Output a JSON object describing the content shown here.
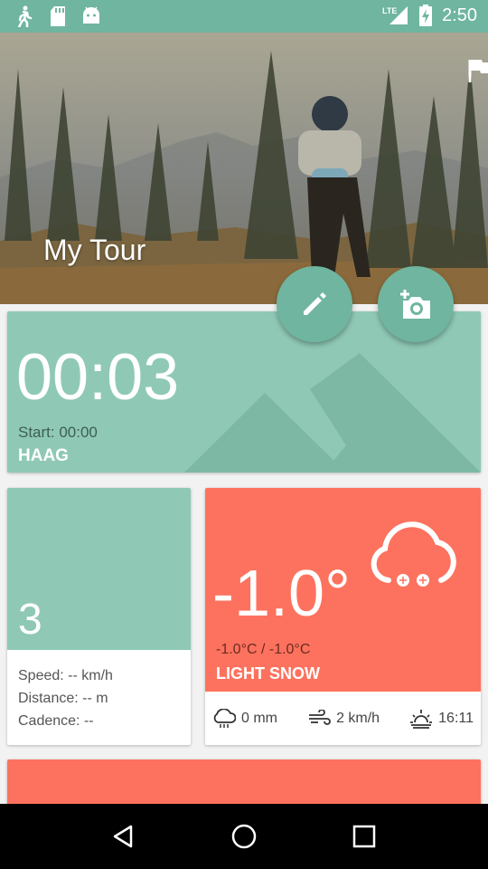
{
  "status_bar": {
    "time": "2:50",
    "network": "LTE",
    "icons": [
      "walk-icon",
      "sd-card-icon",
      "android-icon",
      "signal-icon",
      "battery-charging-icon"
    ]
  },
  "hero": {
    "title": "My Tour",
    "flag_icon": "flag-icon"
  },
  "actions": {
    "edit_icon": "pencil-icon",
    "camera_icon": "add-photo-icon"
  },
  "timer_card": {
    "elapsed": "00:03",
    "start": "Start: 00:00",
    "location": "HAAG"
  },
  "stats_card": {
    "value": "3",
    "speed": "Speed: -- km/h",
    "distance": "Distance: -- m",
    "cadence": "Cadence: --"
  },
  "weather_card": {
    "temperature": "-1.0°",
    "range": "-1.0°C / -1.0°C",
    "condition": "LIGHT SNOW",
    "icon": "snow-cloud-icon",
    "precipitation": "0 mm",
    "wind": "2 km/h",
    "sunset": "16:11"
  },
  "colors": {
    "accent": "#6fb5a0",
    "teal_card": "#8fc9b5",
    "coral": "#fd725e"
  }
}
